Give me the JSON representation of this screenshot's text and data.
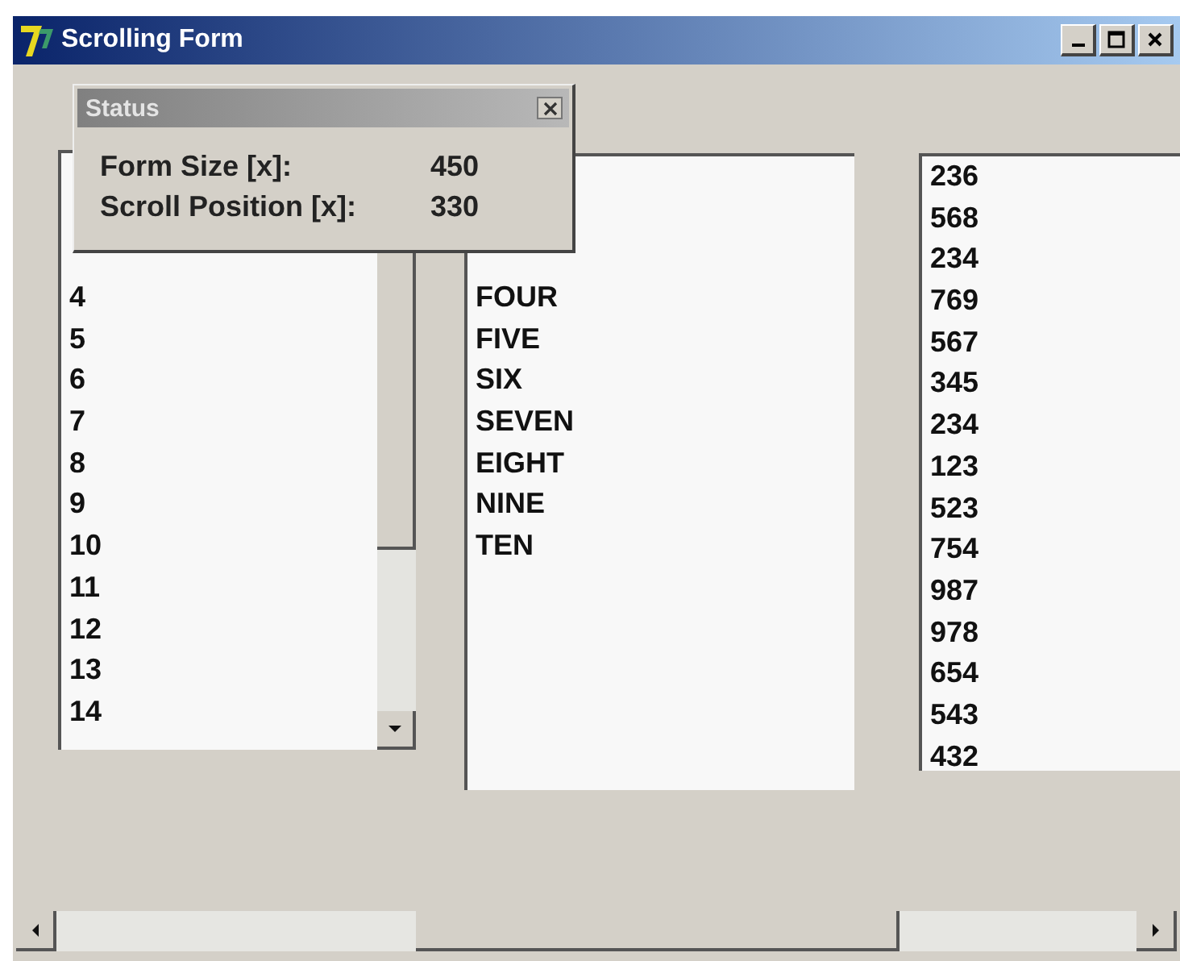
{
  "window": {
    "title": "Scrolling Form"
  },
  "status_window": {
    "title": "Status",
    "rows": [
      {
        "label": "Form Size [x]:",
        "value": "450"
      },
      {
        "label": "Scroll Position [x]:",
        "value": "330"
      }
    ]
  },
  "lists": [
    {
      "kind": "scrollable",
      "items": [
        "4",
        "5",
        "6",
        "7",
        "8",
        "9",
        "10",
        "11",
        "12",
        "13",
        "14"
      ]
    },
    {
      "kind": "plain",
      "items": [
        "FOUR",
        "FIVE",
        "SIX",
        "SEVEN",
        "EIGHT",
        "NINE",
        "TEN"
      ]
    },
    {
      "kind": "plain",
      "items": [
        "236",
        "568",
        "234",
        "769",
        "567",
        "345",
        "234",
        "123",
        "523",
        "754",
        "987",
        "978",
        "654",
        "543",
        "432"
      ]
    }
  ]
}
